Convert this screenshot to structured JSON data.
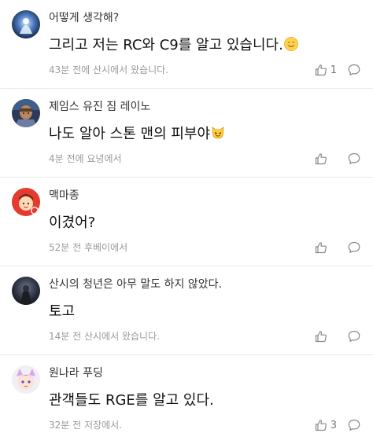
{
  "comments": [
    {
      "author": "어떻게 생각해?",
      "text": "그리고 저는 RC와 C9를 알고 있습니다.",
      "emoji": "smiling-face-emoji",
      "meta": "43분 전에 산시에서 왔습니다.",
      "likes": "1",
      "avatar": "blue-mage-avatar"
    },
    {
      "author": "제임스 유진 짐 레이노",
      "text": "나도 알아 스톤 맨의 피부야",
      "emoji": "cat-face-emoji",
      "meta": "4분 전에 요녕에서",
      "likes": "",
      "avatar": "armored-soldier-avatar"
    },
    {
      "author": "맥마종",
      "text": "이겼어?",
      "emoji": "",
      "meta": "52분 전 후베이에서",
      "likes": "",
      "avatar": "cartoon-kid-avatar"
    },
    {
      "author": "산시의 청년은 아무 말도 하지 않았다.",
      "text": "토고",
      "emoji": "",
      "meta": "14분 전 산시에서 왔습니다.",
      "likes": "",
      "avatar": "dark-figure-avatar"
    },
    {
      "author": "원나라 푸딩",
      "text": "관객들도 RGE를 알고 있다.",
      "emoji": "",
      "meta": "32분 전 저장에서.",
      "likes": "3",
      "avatar": "anime-character-avatar"
    }
  ],
  "icons": {
    "like": "thumbs-up-icon",
    "reply": "speech-bubble-icon"
  },
  "colors": {
    "text": "#111111",
    "meta": "#9a9a9a",
    "divider": "#ececec"
  }
}
